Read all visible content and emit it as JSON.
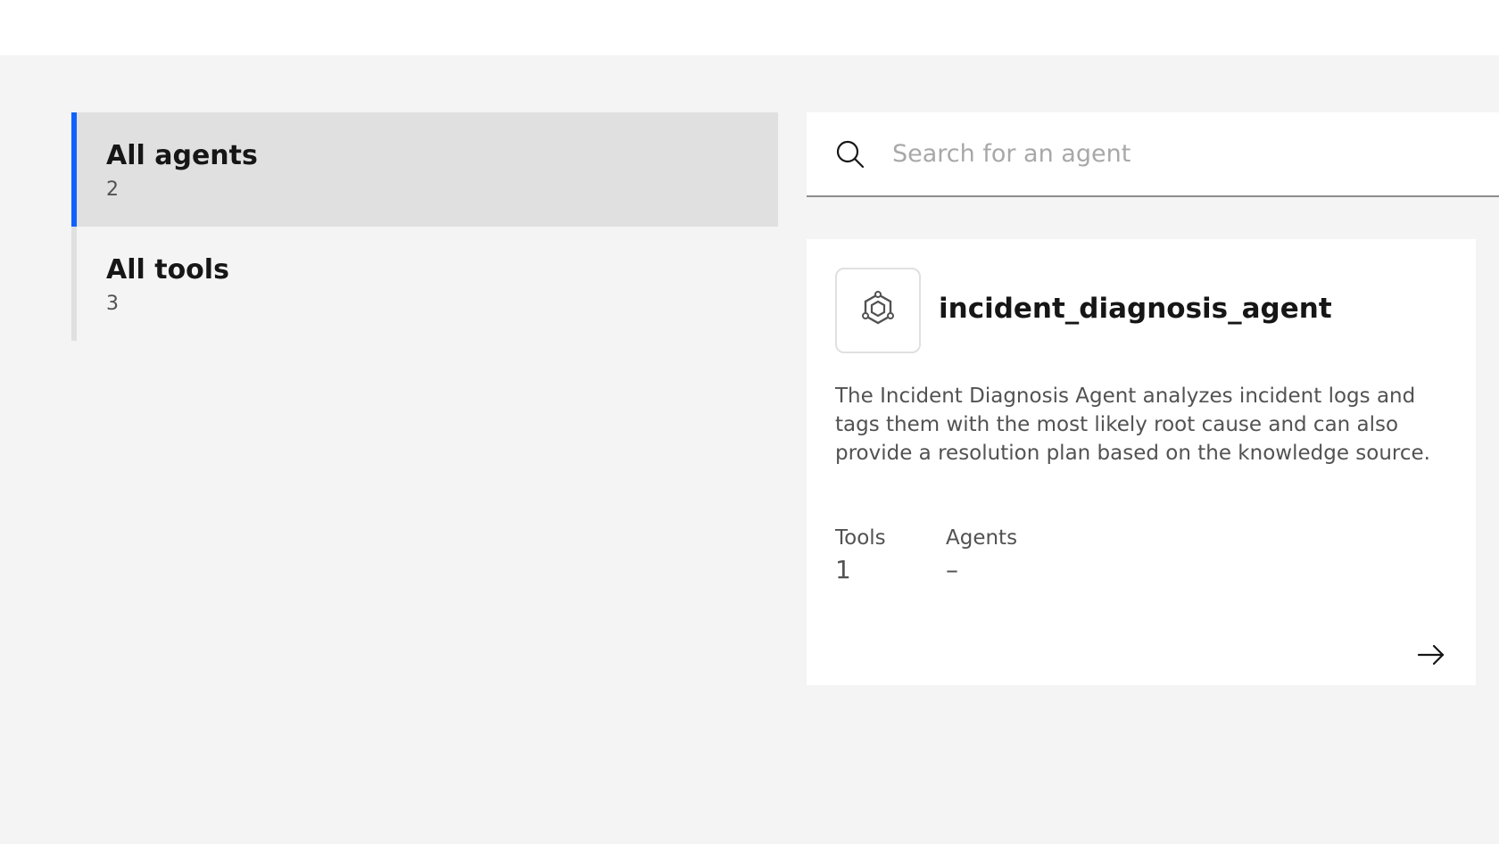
{
  "nav": {
    "items": [
      {
        "label": "All agents",
        "count": "2",
        "active": true
      },
      {
        "label": "All tools",
        "count": "3",
        "active": false
      }
    ]
  },
  "search": {
    "placeholder": "Search for an agent",
    "value": ""
  },
  "card": {
    "icon": "agent-hexagon-icon",
    "name": "incident_diagnosis_agent",
    "description": "The Incident Diagnosis Agent analyzes incident logs and tags them with the most likely root cause and can also provide a resolution plan based on the knowledge source.",
    "stats": [
      {
        "label": "Tools",
        "value": "1"
      },
      {
        "label": "Agents",
        "value": "–"
      }
    ],
    "open_icon": "arrow-right-icon"
  },
  "colors": {
    "accent": "#0f62fe",
    "background": "#f4f4f4",
    "active_nav": "#e0e0e0"
  }
}
